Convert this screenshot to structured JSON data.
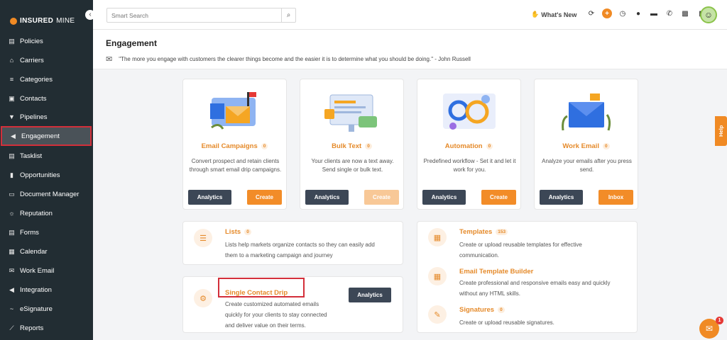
{
  "brand": {
    "name_bold": "INSURED",
    "name_light": "MINE"
  },
  "sidebar": {
    "items": [
      {
        "label": "Policies",
        "icon": "document-icon"
      },
      {
        "label": "Carriers",
        "icon": "bank-icon"
      },
      {
        "label": "Categories",
        "icon": "layers-icon"
      },
      {
        "label": "Contacts",
        "icon": "contact-icon"
      },
      {
        "label": "Pipelines",
        "icon": "funnel-icon"
      },
      {
        "label": "Engagement",
        "icon": "megaphone-icon",
        "active": true
      },
      {
        "label": "Tasklist",
        "icon": "list-icon"
      },
      {
        "label": "Opportunities",
        "icon": "bar-chart-icon"
      },
      {
        "label": "Document Manager",
        "icon": "folder-icon"
      },
      {
        "label": "Reputation",
        "icon": "reputation-icon"
      },
      {
        "label": "Forms",
        "icon": "form-icon"
      },
      {
        "label": "Calendar",
        "icon": "calendar-icon"
      },
      {
        "label": "Work Email",
        "icon": "mail-icon"
      },
      {
        "label": "Integration",
        "icon": "plug-icon"
      },
      {
        "label": "eSignature",
        "icon": "signature-icon"
      },
      {
        "label": "Reports",
        "icon": "line-chart-icon"
      }
    ]
  },
  "topbar": {
    "search_placeholder": "Smart Search",
    "whats_new": "What's New"
  },
  "header": {
    "title": "Engagement",
    "quote": "\"The more you engage with customers the clearer things become and the easier it is to determine what you should be doing.\" - John Russell"
  },
  "tiles": [
    {
      "title": "Email Campaigns",
      "count": "0",
      "desc": "Convert prospect and retain clients through smart email drip campaigns.",
      "btn1": "Analytics",
      "btn2": "Create"
    },
    {
      "title": "Bulk Text",
      "count": "0",
      "desc": "Your clients are now a text away. Send single or bulk text.",
      "btn1": "Analytics",
      "btn2": "Create"
    },
    {
      "title": "Automation",
      "count": "0",
      "desc": "Predefined workflow - Set it and let it work for you.",
      "btn1": "Analytics",
      "btn2": "Create"
    },
    {
      "title": "Work Email",
      "count": "0",
      "desc": "Analyze your emails after you press send.",
      "btn1": "Analytics",
      "btn2": "Inbox"
    }
  ],
  "lists": {
    "title": "Lists",
    "count": "0",
    "desc1": "Lists help markets organize contacts so they can easily add",
    "desc2": "them to a marketing campaign and journey"
  },
  "drip": {
    "title": "Single Contact Drip",
    "desc1": "Create customized automated emails",
    "desc2": "quickly for your clients to stay connected",
    "desc3": "and deliver value on their terms.",
    "btn": "Analytics"
  },
  "templates": {
    "title": "Templates",
    "count": "153",
    "desc1": "Create or upload reusable templates for effective",
    "desc2": "communication."
  },
  "builder": {
    "title": "Email Template Builder",
    "desc1": "Create professional and responsive emails easy and quickly",
    "desc2": "without any HTML skills."
  },
  "signatures": {
    "title": "Signatures",
    "count": "0",
    "desc": "Create or upload reusable signatures."
  },
  "help": {
    "label": "Help"
  },
  "chat": {
    "badge": "1"
  },
  "colors": {
    "accent": "#f28c28",
    "sidebar": "#222d33",
    "dark_button": "#3c4756",
    "highlight": "#d32f3a"
  }
}
